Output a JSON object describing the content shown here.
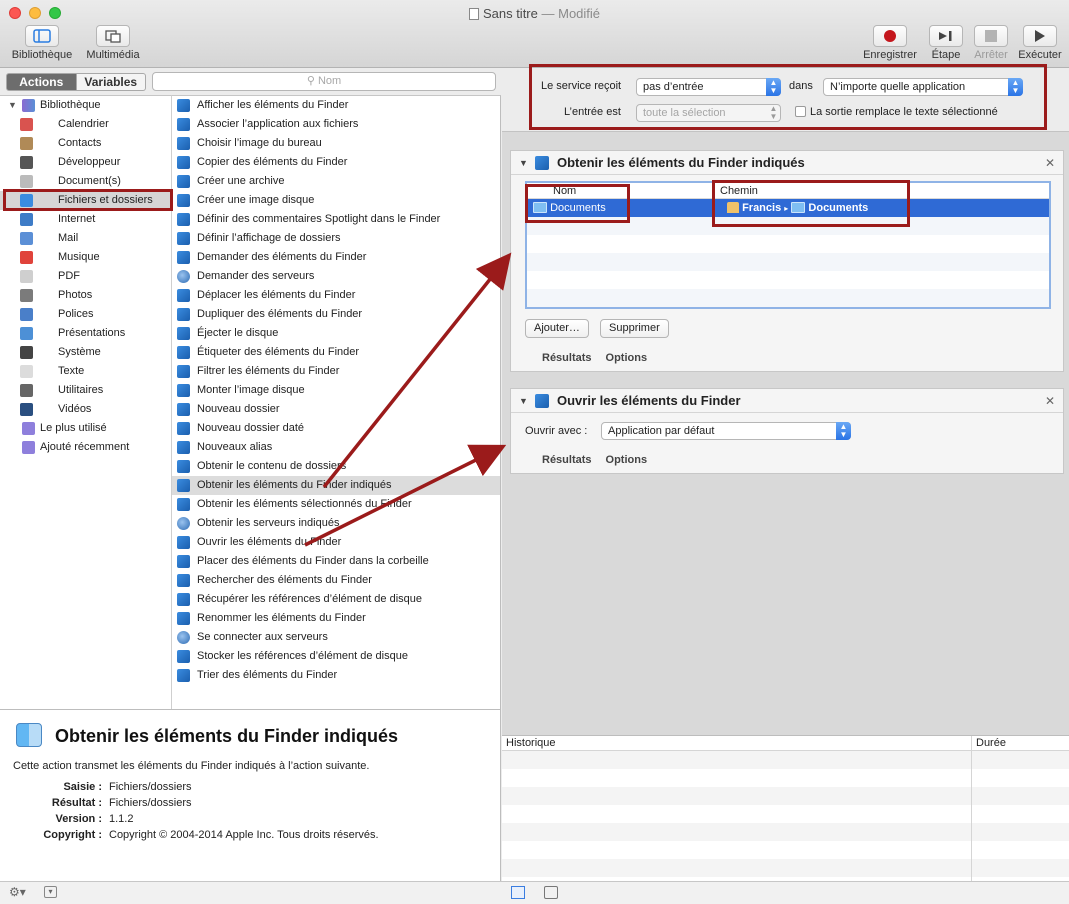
{
  "window": {
    "title": "Sans titre",
    "separator": "—",
    "modified": "Modifié"
  },
  "toolbar_left": [
    {
      "label": "Bibliothèque",
      "icon": "library-icon"
    },
    {
      "label": "Multimédia",
      "icon": "media-icon"
    }
  ],
  "toolbar_right": [
    {
      "label": "Enregistrer",
      "icon": "record-icon"
    },
    {
      "label": "Étape",
      "icon": "step-icon"
    },
    {
      "label": "Arrêter",
      "icon": "stop-icon",
      "disabled": true
    },
    {
      "label": "Exécuter",
      "icon": "run-icon"
    }
  ],
  "segmented": {
    "actions": "Actions",
    "variables": "Variables"
  },
  "search": {
    "placeholder": "Nom",
    "icon": "search-icon"
  },
  "library": {
    "root": "Bibliothèque",
    "items": [
      {
        "label": "Calendrier",
        "color": "#d9534f"
      },
      {
        "label": "Contacts",
        "color": "#b08a57"
      },
      {
        "label": "Développeur",
        "color": "#555555"
      },
      {
        "label": "Document(s)",
        "color": "#bbbbbb"
      },
      {
        "label": "Fichiers et dossiers",
        "color": "#3a8ce0",
        "selected": true
      },
      {
        "label": "Internet",
        "color": "#3e7cc7"
      },
      {
        "label": "Mail",
        "color": "#5b8fd6"
      },
      {
        "label": "Musique",
        "color": "#e0433b"
      },
      {
        "label": "PDF",
        "color": "#cfcfcf"
      },
      {
        "label": "Photos",
        "color": "#7b7b7b"
      },
      {
        "label": "Polices",
        "color": "#4a7fc9"
      },
      {
        "label": "Présentations",
        "color": "#4d90d6"
      },
      {
        "label": "Système",
        "color": "#444444"
      },
      {
        "label": "Texte",
        "color": "#dcdcdc"
      },
      {
        "label": "Utilitaires",
        "color": "#666666"
      },
      {
        "label": "Vidéos",
        "color": "#2a4f80"
      }
    ],
    "extras": [
      {
        "label": "Le plus utilisé",
        "color": "#8e7fdc"
      },
      {
        "label": "Ajouté récemment",
        "color": "#8e7fdc"
      }
    ]
  },
  "actions": [
    {
      "label": "Afficher les éléments du Finder"
    },
    {
      "label": "Associer l’application aux fichiers"
    },
    {
      "label": "Choisir l’image du bureau"
    },
    {
      "label": "Copier des éléments du Finder"
    },
    {
      "label": "Créer une archive"
    },
    {
      "label": "Créer une image disque"
    },
    {
      "label": "Définir des commentaires Spotlight dans le Finder"
    },
    {
      "label": "Définir l’affichage de dossiers"
    },
    {
      "label": "Demander des éléments du Finder"
    },
    {
      "label": "Demander des serveurs",
      "globe": true
    },
    {
      "label": "Déplacer les éléments du Finder"
    },
    {
      "label": "Dupliquer des éléments du Finder"
    },
    {
      "label": "Éjecter le disque"
    },
    {
      "label": "Étiqueter des éléments du Finder"
    },
    {
      "label": "Filtrer les éléments du Finder"
    },
    {
      "label": "Monter l’image disque"
    },
    {
      "label": "Nouveau dossier"
    },
    {
      "label": "Nouveau dossier daté"
    },
    {
      "label": "Nouveaux alias"
    },
    {
      "label": "Obtenir le contenu de dossiers"
    },
    {
      "label": "Obtenir les éléments du Finder indiqués",
      "selected": true
    },
    {
      "label": "Obtenir les éléments sélectionnés du Finder"
    },
    {
      "label": "Obtenir les serveurs indiqués",
      "globe": true
    },
    {
      "label": "Ouvrir les éléments du Finder"
    },
    {
      "label": "Placer des éléments du Finder dans la corbeille"
    },
    {
      "label": "Rechercher des éléments du Finder"
    },
    {
      "label": "Récupérer les références d’élément de disque"
    },
    {
      "label": "Renommer les éléments du Finder"
    },
    {
      "label": "Se connecter aux serveurs",
      "globe": true
    },
    {
      "label": "Stocker les références d’élément de disque"
    },
    {
      "label": "Trier des éléments du Finder"
    }
  ],
  "info": {
    "title": "Obtenir les éléments du Finder indiqués",
    "description": "Cette action transmet les éléments du Finder indiqués à l’action suivante.",
    "fields": [
      {
        "key": "Saisie :",
        "value": "Fichiers/dossiers"
      },
      {
        "key": "Résultat :",
        "value": "Fichiers/dossiers"
      },
      {
        "key": "Version :",
        "value": "1.1.2"
      },
      {
        "key": "Copyright :",
        "value": "Copyright © 2004-2014 Apple Inc. Tous droits réservés."
      }
    ]
  },
  "service": {
    "receives_label": "Le service reçoit",
    "receives_value": "pas d’entrée",
    "in_label": "dans",
    "in_value": "N’importe quelle application",
    "input_label": "L’entrée est",
    "input_value": "toute la sélection",
    "replace_label": "La sortie remplace le texte sélectionné"
  },
  "card1": {
    "title": "Obtenir les éléments du Finder indiqués",
    "col_name": "Nom",
    "col_path": "Chemin",
    "row_name": "Documents",
    "path_home": "Francis",
    "path_sep": "▸",
    "path_folder": "Documents",
    "add": "Ajouter…",
    "remove": "Supprimer",
    "results": "Résultats",
    "options": "Options"
  },
  "card2": {
    "title": "Ouvrir les éléments du Finder",
    "open_with_label": "Ouvrir avec :",
    "open_with_value": "Application par défaut",
    "results": "Résultats",
    "options": "Options"
  },
  "history": {
    "col_history": "Historique",
    "col_duration": "Durée"
  },
  "colors": {
    "annotation": "#9b1b1b",
    "selection": "#2f6ad5"
  }
}
